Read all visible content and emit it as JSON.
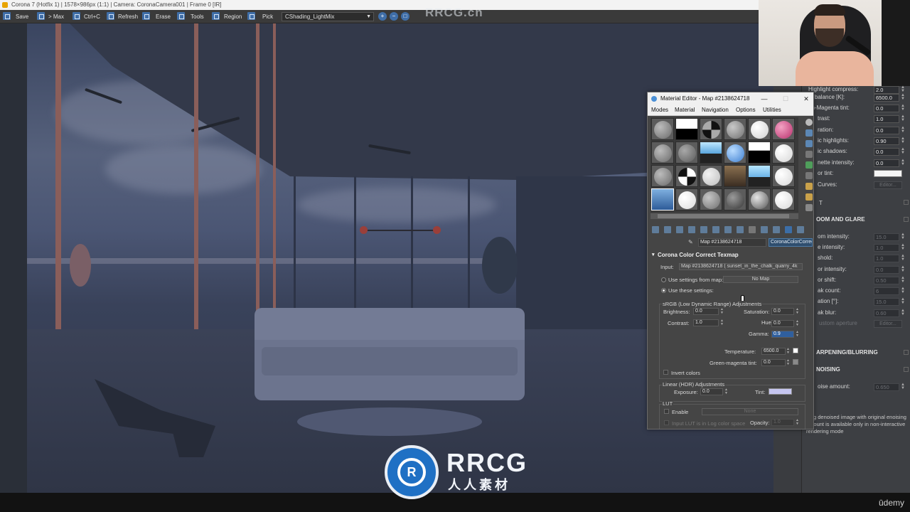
{
  "vfb": {
    "title": "Corona 7 (Hotfix 1) | 1578×986px (1:1) | Camera: CoronaCamera001 | Frame 0 [IR]",
    "toolbar": {
      "save": "Save",
      "max": "> Max",
      "copy": "Ctrl+C",
      "refresh": "Refresh",
      "erase": "Erase",
      "tools": "Tools",
      "region": "Region",
      "pick": "Pick",
      "render_element": "CShading_LightMix"
    }
  },
  "watermark": {
    "top": "RRCG.cn",
    "logo_letter": "R",
    "name": "RRCG",
    "sub": "人人素材"
  },
  "brand": "ūdemy",
  "material_editor": {
    "title": "Material Editor - Map #2138624718",
    "menu": [
      "Modes",
      "Material",
      "Navigation",
      "Options",
      "Utilities"
    ],
    "map_name": "Map #2138624718",
    "map_type": "CoronaColorCorrect",
    "rollout_title": "Corona Color Correct Texmap",
    "input_label": "Input:",
    "input_value": "Map #2138624718 ( sunset_in_the_chalk_quarry_4k",
    "use_settings_from_map": "Use settings from map:",
    "no_map": "No Map",
    "use_these_settings": "Use these settings:",
    "srgb_group": "sRGB (Low Dynamic Range) Adjustments",
    "brightness_label": "Brightness:",
    "brightness": "0.0",
    "saturation_label": "Saturation:",
    "saturation": "0.0",
    "contrast_label": "Contrast:",
    "contrast": "1.0",
    "hue_label": "Hue:",
    "hue": "0.0",
    "gamma_label": "Gamma:",
    "gamma": "0.9",
    "temperature_label": "Temperature:",
    "temperature": "6500.0",
    "gm_tint_label": "Green-magenta tint:",
    "gm_tint": "0.0",
    "invert_colors": "Invert colors",
    "hdr_group": "Linear (HDR) Adjustments",
    "exposure_label": "Exposure:",
    "exposure": "0.0",
    "tint_label": "Tint:",
    "lut_group": "LUT",
    "enable": "Enable",
    "lut_none": "None",
    "lut_log": "Input LUT is in Log color space",
    "opacity_label": "Opacity:",
    "opacity": "1.0"
  },
  "corona_panel": {
    "tonemap_rows": [
      {
        "label": "Highlight compress:",
        "value": "2.0"
      },
      {
        "label": "te balance [K]:",
        "value": "6500.0"
      },
      {
        "label": "en-Magenta tint:",
        "value": "0.0"
      },
      {
        "label": "trast:",
        "value": "1.0"
      },
      {
        "label": "ration:",
        "value": "0.0"
      },
      {
        "label": "ic highlights:",
        "value": "0.90"
      },
      {
        "label": "ic shadows:",
        "value": "0.0"
      },
      {
        "label": "nette intensity:",
        "value": "0.0"
      }
    ],
    "tint_label": "or tint:",
    "curves_label": "Curves:",
    "curves_btn": "Editor...",
    "lut_label": "T",
    "bloom_title": "OOM AND GLARE",
    "bloom_rows": [
      {
        "label": "om intensity:",
        "value": "15.0"
      },
      {
        "label": "e intensity:",
        "value": "1.0"
      },
      {
        "label": "shold:",
        "value": "1.0"
      },
      {
        "label": "or intensity:",
        "value": "0.0"
      },
      {
        "label": "or shift:",
        "value": "0.50"
      },
      {
        "label": "ak count:",
        "value": "6"
      },
      {
        "label": "ation [°]:",
        "value": "15.0"
      },
      {
        "label": "ak blur:",
        "value": "0.60"
      }
    ],
    "aperture_label": "ustom aperture",
    "aperture_btn": "Editor...",
    "sharpening_title": "ARPENING/BLURRING",
    "denoising_title": "NOISING",
    "denoise_label": "oise amount:",
    "denoise_value": "0.650",
    "note": "ding denoised image with original enoising amount is available only in non-interactive rendering mode"
  },
  "colors": {
    "accent": "#3f6ea8",
    "tint_swatch": "#c6c6f0",
    "slot_pink": "#d8568f",
    "slot_blue": "#5fa3e8"
  }
}
